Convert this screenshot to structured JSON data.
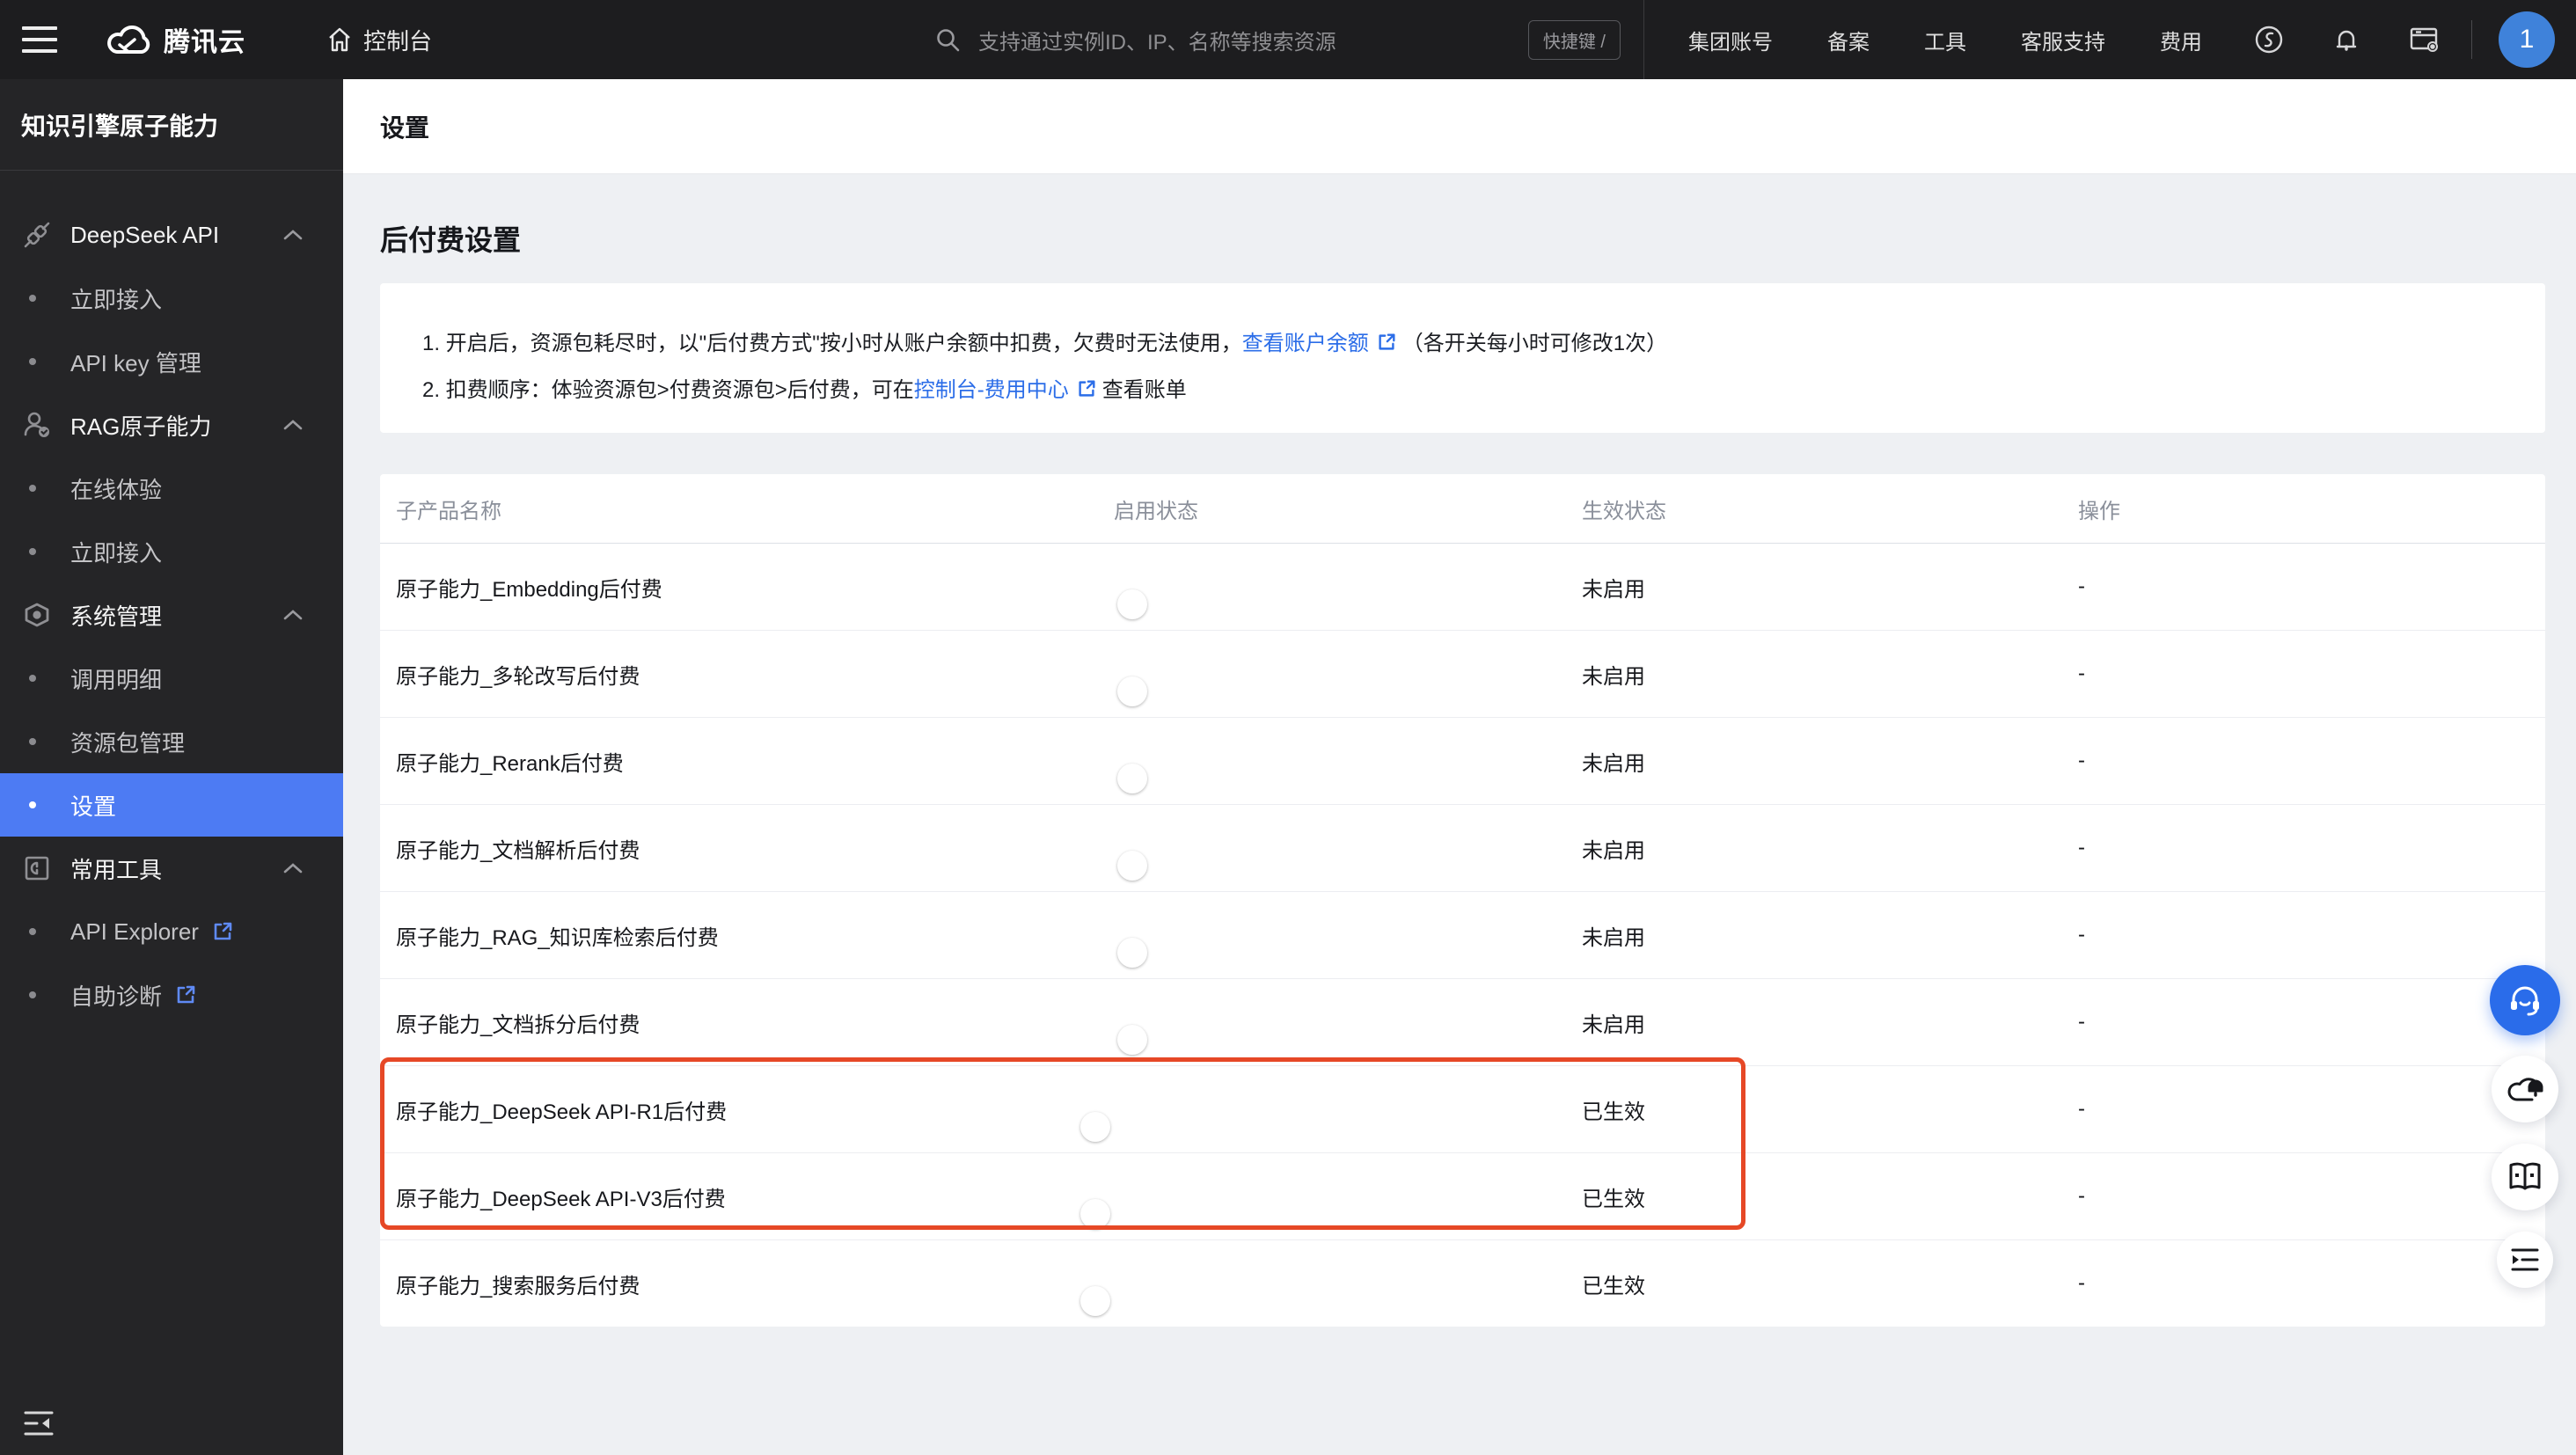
{
  "topbar": {
    "brand": "腾讯云",
    "console_label": "控制台",
    "search_placeholder": "支持通过实例ID、IP、名称等搜索资源",
    "shortcut_badge": "快捷键 /",
    "nav": [
      "集团账号",
      "备案",
      "工具",
      "客服支持",
      "费用"
    ],
    "avatar_label": "1"
  },
  "sidebar": {
    "title": "知识引擎原子能力",
    "menu": [
      {
        "type": "section",
        "icon": "plug-icon",
        "label": "DeepSeek API"
      },
      {
        "type": "item",
        "label": "立即接入"
      },
      {
        "type": "item",
        "label": "API key 管理"
      },
      {
        "type": "section",
        "icon": "user-check-icon",
        "label": "RAG原子能力"
      },
      {
        "type": "item",
        "label": "在线体验"
      },
      {
        "type": "item",
        "label": "立即接入"
      },
      {
        "type": "section",
        "icon": "nut-icon",
        "label": "系统管理"
      },
      {
        "type": "item",
        "label": "调用明细"
      },
      {
        "type": "item",
        "label": "资源包管理"
      },
      {
        "type": "item",
        "label": "设置",
        "selected": true
      },
      {
        "type": "section",
        "icon": "toolbox-icon",
        "label": "常用工具"
      },
      {
        "type": "item",
        "label": "API Explorer",
        "external": true
      },
      {
        "type": "item",
        "label": "自助诊断",
        "external": true
      }
    ]
  },
  "page": {
    "title": "设置",
    "section_title": "后付费设置",
    "notice": {
      "line1_prefix": "1. 开启后，资源包耗尽时，以\"后付费方式\"按小时从账户余额中扣费，欠费时无法使用，",
      "line1_link": "查看账户余额",
      "line1_suffix": "（各开关每小时可修改1次）",
      "line2_prefix": "2. 扣费顺序：体验资源包>付费资源包>后付费，可在",
      "line2_link": "控制台-费用中心",
      "line2_suffix": "查看账单"
    },
    "table": {
      "headers": [
        "子产品名称",
        "启用状态",
        "生效状态",
        "操作"
      ],
      "rows": [
        {
          "name": "原子能力_Embedding后付费",
          "enabled": false,
          "status": "未启用",
          "action": "-"
        },
        {
          "name": "原子能力_多轮改写后付费",
          "enabled": false,
          "status": "未启用",
          "action": "-"
        },
        {
          "name": "原子能力_Rerank后付费",
          "enabled": false,
          "status": "未启用",
          "action": "-"
        },
        {
          "name": "原子能力_文档解析后付费",
          "enabled": false,
          "status": "未启用",
          "action": "-"
        },
        {
          "name": "原子能力_RAG_知识库检索后付费",
          "enabled": false,
          "status": "未启用",
          "action": "-"
        },
        {
          "name": "原子能力_文档拆分后付费",
          "enabled": false,
          "status": "未启用",
          "action": "-"
        },
        {
          "name": "原子能力_DeepSeek API-R1后付费",
          "enabled": true,
          "status": "已生效",
          "action": "-"
        },
        {
          "name": "原子能力_DeepSeek API-V3后付费",
          "enabled": true,
          "status": "已生效",
          "action": "-"
        },
        {
          "name": "原子能力_搜索服务后付费",
          "enabled": true,
          "status": "已生效",
          "action": "-"
        }
      ]
    }
  },
  "colors": {
    "topbar_bg": "#1d1d1f",
    "sidebar_bg": "#252527",
    "selected_blue": "#4d7bf3",
    "link_blue": "#2b6de8",
    "toggle_on": "#2a6cea",
    "toggle_off": "#98a2b5",
    "annotation_red": "#e64826",
    "avatar_blue": "#3f82da",
    "content_bg": "#eef0f3"
  }
}
